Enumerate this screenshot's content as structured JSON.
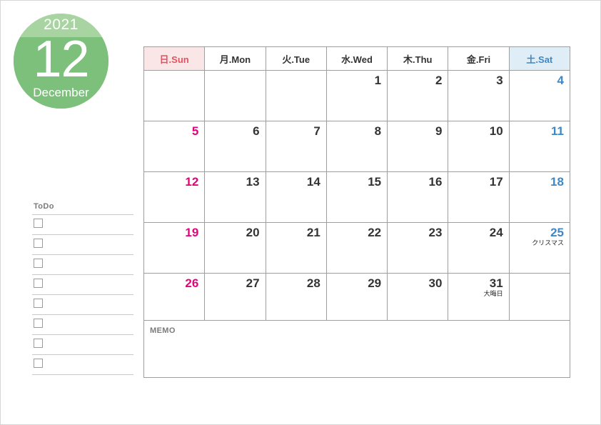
{
  "badge": {
    "year": "2021",
    "month_number": "12",
    "month_name": "December",
    "color_top": "#a7d4a0",
    "color_bottom": "#7cc07c"
  },
  "todo": {
    "title": "ToDo",
    "row_count": 8
  },
  "memo": {
    "label": "MEMO"
  },
  "calendar": {
    "headers": [
      {
        "label": "日.Sun",
        "kind": "sun"
      },
      {
        "label": "月.Mon",
        "kind": "wd"
      },
      {
        "label": "火.Tue",
        "kind": "wd"
      },
      {
        "label": "水.Wed",
        "kind": "wd"
      },
      {
        "label": "木.Thu",
        "kind": "wd"
      },
      {
        "label": "金.Fri",
        "kind": "wd"
      },
      {
        "label": "土.Sat",
        "kind": "sat"
      }
    ],
    "weeks": [
      [
        {
          "day": "",
          "event": ""
        },
        {
          "day": "",
          "event": ""
        },
        {
          "day": "",
          "event": ""
        },
        {
          "day": "1",
          "event": ""
        },
        {
          "day": "2",
          "event": ""
        },
        {
          "day": "3",
          "event": ""
        },
        {
          "day": "4",
          "event": ""
        }
      ],
      [
        {
          "day": "5",
          "event": ""
        },
        {
          "day": "6",
          "event": ""
        },
        {
          "day": "7",
          "event": ""
        },
        {
          "day": "8",
          "event": ""
        },
        {
          "day": "9",
          "event": ""
        },
        {
          "day": "10",
          "event": ""
        },
        {
          "day": "11",
          "event": ""
        }
      ],
      [
        {
          "day": "12",
          "event": ""
        },
        {
          "day": "13",
          "event": ""
        },
        {
          "day": "14",
          "event": ""
        },
        {
          "day": "15",
          "event": ""
        },
        {
          "day": "16",
          "event": ""
        },
        {
          "day": "17",
          "event": ""
        },
        {
          "day": "18",
          "event": ""
        }
      ],
      [
        {
          "day": "19",
          "event": ""
        },
        {
          "day": "20",
          "event": ""
        },
        {
          "day": "21",
          "event": ""
        },
        {
          "day": "22",
          "event": ""
        },
        {
          "day": "23",
          "event": ""
        },
        {
          "day": "24",
          "event": ""
        },
        {
          "day": "25",
          "event": "クリスマス"
        }
      ],
      [
        {
          "day": "26",
          "event": ""
        },
        {
          "day": "27",
          "event": ""
        },
        {
          "day": "28",
          "event": ""
        },
        {
          "day": "29",
          "event": ""
        },
        {
          "day": "30",
          "event": ""
        },
        {
          "day": "31",
          "event": "大晦日"
        },
        {
          "day": "",
          "event": ""
        }
      ]
    ],
    "colors": {
      "sunday_header_bg": "#fbe6e7",
      "sunday_header_text": "#e05361",
      "saturday_header_bg": "#dfedf6",
      "saturday_header_text": "#3f88c5",
      "sunday_date": "#e6007e",
      "saturday_date": "#3f88c5",
      "weekday_date": "#333333",
      "grid_line": "#9e9e9e"
    }
  }
}
